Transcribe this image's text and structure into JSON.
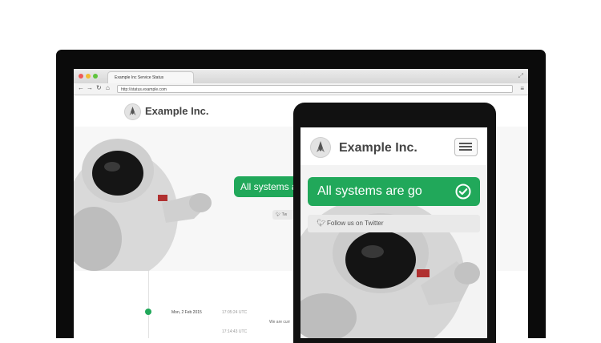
{
  "browser": {
    "tab_title": "Example Inc Service Status",
    "url": "http://status.example.com"
  },
  "desktop": {
    "brand": "Example Inc.",
    "status_text": "All systems a",
    "twitter_short": "Tw",
    "timeline": {
      "date": "Mon, 2 Feb 2015",
      "time1": "17:05:24 UTC",
      "time2": "17:14:43 UTC",
      "message_partial": "We are curr"
    }
  },
  "mobile": {
    "brand": "Example Inc.",
    "status_text": "All systems are go",
    "twitter_label": "Follow us on Twitter"
  },
  "colors": {
    "status_green": "#21a85a"
  }
}
